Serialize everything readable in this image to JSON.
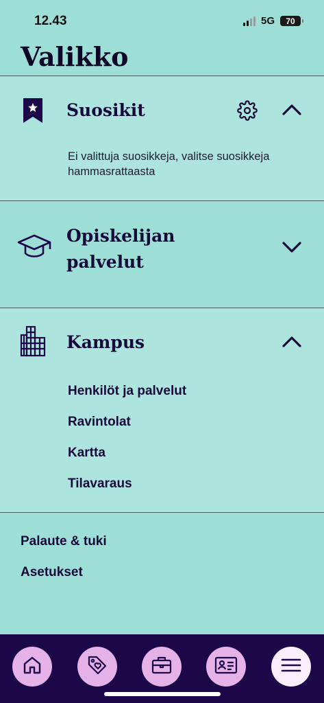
{
  "status_bar": {
    "time": "12.43",
    "network": "5G",
    "battery": "70"
  },
  "page": {
    "title": "Valikko"
  },
  "sections": {
    "favorites": {
      "title": "Suosikit",
      "description": "Ei valittuja suosikkeja, valitse suosikkeja hammasrattaasta",
      "expanded": true,
      "icon": "bookmark-star-icon"
    },
    "student_services": {
      "title_line1": "Opiskelijan",
      "title_line2": "palvelut",
      "expanded": false,
      "icon": "graduation-cap-icon"
    },
    "campus": {
      "title": "Kampus",
      "expanded": true,
      "icon": "building-icon",
      "items": [
        "Henkilöt ja palvelut",
        "Ravintolat",
        "Kartta",
        "Tilavaraus"
      ]
    }
  },
  "links": [
    "Palaute & tuki",
    "Asetukset"
  ],
  "tab_bar": {
    "tabs": [
      "home-icon",
      "tag-heart-icon",
      "briefcase-icon",
      "id-card-icon",
      "menu-icon"
    ],
    "active_tab": "menu-icon"
  },
  "colors": {
    "background": "#9ddfd6",
    "section_open": "#ade5de",
    "text_dark": "#160a3a",
    "tab_bar": "#1c0848",
    "tab_button": "#e4b2e6",
    "tab_button_active": "#fbeefd"
  }
}
